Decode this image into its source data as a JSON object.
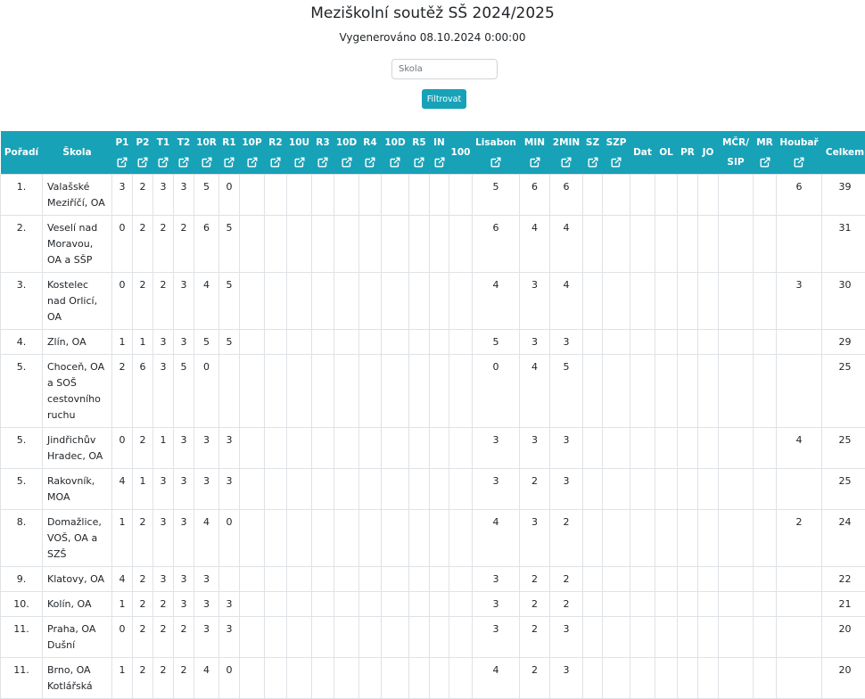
{
  "page": {
    "title": "Meziškolní soutěž SŠ 2024/2025",
    "generated": "Vygenerováno 08.10.2024 0:00:00"
  },
  "filter": {
    "placeholder": "Škola",
    "button_label": "Filtrovat"
  },
  "table": {
    "columns": [
      {
        "id": "poradi",
        "label": "Pořadí",
        "link": false
      },
      {
        "id": "skola",
        "label": "Škola",
        "link": false
      },
      {
        "id": "p1",
        "label": "P1",
        "link": true
      },
      {
        "id": "p2",
        "label": "P2",
        "link": true
      },
      {
        "id": "t1",
        "label": "T1",
        "link": true
      },
      {
        "id": "t2",
        "label": "T2",
        "link": true
      },
      {
        "id": "10r",
        "label": "10R",
        "link": true
      },
      {
        "id": "r1",
        "label": "R1",
        "link": true
      },
      {
        "id": "10p",
        "label": "10P",
        "link": true
      },
      {
        "id": "r2",
        "label": "R2",
        "link": true
      },
      {
        "id": "10u",
        "label": "10U",
        "link": true
      },
      {
        "id": "r3",
        "label": "R3",
        "link": true
      },
      {
        "id": "10d",
        "label": "10D",
        "link": true
      },
      {
        "id": "r4",
        "label": "R4",
        "link": true
      },
      {
        "id": "10d2",
        "label": "10D",
        "link": true
      },
      {
        "id": "r5",
        "label": "R5",
        "link": true
      },
      {
        "id": "in",
        "label": "IN",
        "link": true
      },
      {
        "id": "100",
        "label": "100",
        "link": false
      },
      {
        "id": "lisabon",
        "label": "Lisabon",
        "link": true
      },
      {
        "id": "min",
        "label": "MIN",
        "link": true
      },
      {
        "id": "2min",
        "label": "2MIN",
        "link": true
      },
      {
        "id": "sz",
        "label": "SZ",
        "link": true
      },
      {
        "id": "szp",
        "label": "SZP",
        "link": true
      },
      {
        "id": "dat",
        "label": "Dat",
        "link": false
      },
      {
        "id": "ol",
        "label": "OL",
        "link": false
      },
      {
        "id": "pr",
        "label": "PR",
        "link": false
      },
      {
        "id": "jo",
        "label": "JO",
        "link": false
      },
      {
        "id": "mcr",
        "label": "MČR/",
        "label2": "SIP",
        "link": false
      },
      {
        "id": "mr",
        "label": "MR",
        "link": true
      },
      {
        "id": "houbar",
        "label": "Houbař",
        "link": true
      },
      {
        "id": "celkem",
        "label": "Celkem",
        "link": false
      }
    ],
    "rows": [
      {
        "rank": "1.",
        "school": "Valašské Meziříčí, OA",
        "cells": [
          "3",
          "2",
          "3",
          "3",
          "5",
          "0",
          "",
          "",
          "",
          "",
          "",
          "",
          "",
          "",
          "",
          "",
          "5",
          "6",
          "6",
          "",
          "",
          "",
          "",
          "",
          "",
          "",
          "",
          "6",
          "39"
        ]
      },
      {
        "rank": "2.",
        "school": "Veselí nad Moravou, OA a SŠP",
        "cells": [
          "0",
          "2",
          "2",
          "2",
          "6",
          "5",
          "",
          "",
          "",
          "",
          "",
          "",
          "",
          "",
          "",
          "",
          "6",
          "4",
          "4",
          "",
          "",
          "",
          "",
          "",
          "",
          "",
          "",
          "",
          "31"
        ]
      },
      {
        "rank": "3.",
        "school": "Kostelec nad Orlicí, OA",
        "cells": [
          "0",
          "2",
          "2",
          "3",
          "4",
          "5",
          "",
          "",
          "",
          "",
          "",
          "",
          "",
          "",
          "",
          "",
          "4",
          "3",
          "4",
          "",
          "",
          "",
          "",
          "",
          "",
          "",
          "",
          "3",
          "30"
        ]
      },
      {
        "rank": "4.",
        "school": "Zlín, OA",
        "cells": [
          "1",
          "1",
          "3",
          "3",
          "5",
          "5",
          "",
          "",
          "",
          "",
          "",
          "",
          "",
          "",
          "",
          "",
          "5",
          "3",
          "3",
          "",
          "",
          "",
          "",
          "",
          "",
          "",
          "",
          "",
          "29"
        ]
      },
      {
        "rank": "5.",
        "school": "Choceň, OA a SOŠ cestovního ruchu",
        "cells": [
          "2",
          "6",
          "3",
          "5",
          "0",
          "",
          "",
          "",
          "",
          "",
          "",
          "",
          "",
          "",
          "",
          "",
          "0",
          "4",
          "5",
          "",
          "",
          "",
          "",
          "",
          "",
          "",
          "",
          "",
          "25"
        ]
      },
      {
        "rank": "5.",
        "school": "Jindřichův Hradec, OA",
        "cells": [
          "0",
          "2",
          "1",
          "3",
          "3",
          "3",
          "",
          "",
          "",
          "",
          "",
          "",
          "",
          "",
          "",
          "",
          "3",
          "3",
          "3",
          "",
          "",
          "",
          "",
          "",
          "",
          "",
          "",
          "4",
          "25"
        ]
      },
      {
        "rank": "5.",
        "school": "Rakovník, MOA",
        "cells": [
          "4",
          "1",
          "3",
          "3",
          "3",
          "3",
          "",
          "",
          "",
          "",
          "",
          "",
          "",
          "",
          "",
          "",
          "3",
          "2",
          "3",
          "",
          "",
          "",
          "",
          "",
          "",
          "",
          "",
          "",
          "25"
        ]
      },
      {
        "rank": "8.",
        "school": "Domažlice, VOŠ, OA a SZŠ",
        "cells": [
          "1",
          "2",
          "3",
          "3",
          "4",
          "0",
          "",
          "",
          "",
          "",
          "",
          "",
          "",
          "",
          "",
          "",
          "4",
          "3",
          "2",
          "",
          "",
          "",
          "",
          "",
          "",
          "",
          "",
          "2",
          "24"
        ]
      },
      {
        "rank": "9.",
        "school": "Klatovy, OA",
        "cells": [
          "4",
          "2",
          "3",
          "3",
          "3",
          "",
          "",
          "",
          "",
          "",
          "",
          "",
          "",
          "",
          "",
          "",
          "3",
          "2",
          "2",
          "",
          "",
          "",
          "",
          "",
          "",
          "",
          "",
          "",
          "22"
        ]
      },
      {
        "rank": "10.",
        "school": "Kolín, OA",
        "cells": [
          "1",
          "2",
          "2",
          "3",
          "3",
          "3",
          "",
          "",
          "",
          "",
          "",
          "",
          "",
          "",
          "",
          "",
          "3",
          "2",
          "2",
          "",
          "",
          "",
          "",
          "",
          "",
          "",
          "",
          "",
          "21"
        ]
      },
      {
        "rank": "11.",
        "school": "Praha, OA Dušní",
        "cells": [
          "0",
          "2",
          "2",
          "2",
          "3",
          "3",
          "",
          "",
          "",
          "",
          "",
          "",
          "",
          "",
          "",
          "",
          "3",
          "2",
          "3",
          "",
          "",
          "",
          "",
          "",
          "",
          "",
          "",
          "",
          "20"
        ]
      },
      {
        "rank": "11.",
        "school": "Brno, OA Kotlářská",
        "cells": [
          "1",
          "2",
          "2",
          "2",
          "4",
          "0",
          "",
          "",
          "",
          "",
          "",
          "",
          "",
          "",
          "",
          "",
          "4",
          "2",
          "3",
          "",
          "",
          "",
          "",
          "",
          "",
          "",
          "",
          "",
          "20"
        ]
      }
    ]
  },
  "icons": {
    "column_link": "external-link-icon"
  },
  "colors": {
    "header_bg": "#17a2b8",
    "header_text": "#ffffff",
    "border": "#dee2e6"
  }
}
